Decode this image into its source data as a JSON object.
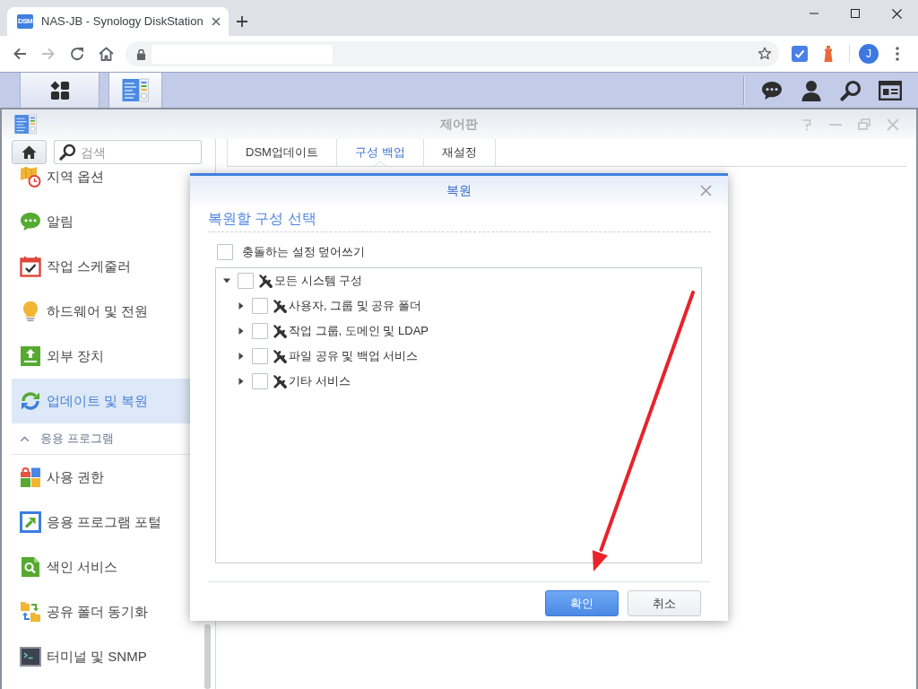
{
  "browser": {
    "tab": {
      "favicon_text": "DSM",
      "title": "NAS-JB - Synology DiskStation",
      "selected": true
    },
    "forward_disabled": true,
    "profile_initial": "J"
  },
  "window": {
    "title": "제어판"
  },
  "sidebar": {
    "search": {
      "placeholder": "검색"
    },
    "groups": [
      {
        "items": [
          {
            "label": "지역 옵션",
            "selected": false
          },
          {
            "label": "알림",
            "selected": false
          },
          {
            "label": "작업 스케줄러",
            "selected": false
          },
          {
            "label": "하드웨어 및 전원",
            "selected": false
          },
          {
            "label": "외부 장치",
            "selected": false
          },
          {
            "label": "업데이트 및 복원",
            "selected": true
          }
        ]
      },
      {
        "header": "응용 프로그램",
        "expanded": true,
        "items": [
          {
            "label": "사용 권한",
            "selected": false
          },
          {
            "label": "응용 프로그램 포털",
            "selected": false
          },
          {
            "label": "색인 서비스",
            "selected": false
          },
          {
            "label": "공유 폴더 동기화",
            "selected": false
          },
          {
            "label": "터미널 및 SNMP",
            "selected": false
          }
        ]
      }
    ]
  },
  "tabs": [
    {
      "label": "DSM업데이트",
      "selected": false
    },
    {
      "label": "구성 백업",
      "selected": true
    },
    {
      "label": "재설정",
      "selected": false
    }
  ],
  "dialog": {
    "title": "복원",
    "section_title": "복원할 구성 선택",
    "overwrite": {
      "label": "충돌하는 설정 덮어쓰기",
      "checked": false
    },
    "tree": [
      {
        "label": "모든 시스템 구성",
        "checked": false,
        "expanded": true,
        "children": [
          {
            "label": "사용자, 그룹 및 공유 폴더",
            "checked": false,
            "expanded": false
          },
          {
            "label": "작업 그룹, 도메인 및 LDAP",
            "checked": false,
            "expanded": false
          },
          {
            "label": "파일 공유 및 백업 서비스",
            "checked": false,
            "expanded": false
          },
          {
            "label": "기타 서비스",
            "checked": false,
            "expanded": false
          }
        ]
      }
    ],
    "buttons": [
      {
        "label": "확인",
        "kind": "primary"
      },
      {
        "label": "취소",
        "kind": "default"
      }
    ]
  }
}
